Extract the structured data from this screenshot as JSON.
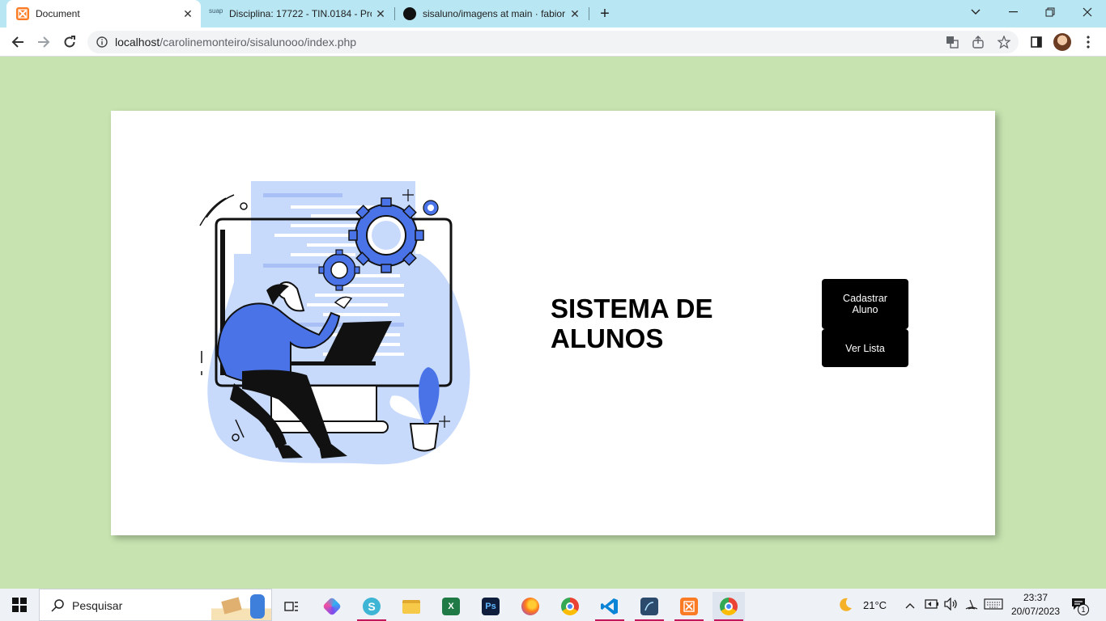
{
  "browser": {
    "tabs": [
      {
        "title": "Document",
        "active": true
      },
      {
        "title": "Disciplina: 17722 - TIN.0184 - Pro",
        "favicon_text": "suap"
      },
      {
        "title": "sisaluno/imagens at main · fabior"
      }
    ],
    "url_host": "localhost",
    "url_path": "/carolinemonteiro/sisalunooo/index.php"
  },
  "page": {
    "title": "SISTEMA DE ALUNOS",
    "buttons": {
      "cadastrar": "Cadastrar Aluno",
      "ver_lista": "Ver Lista"
    }
  },
  "taskbar": {
    "search_placeholder": "Pesquisar",
    "weather": "21°C",
    "time": "23:37",
    "date": "20/07/2023",
    "notifications_count": "1"
  },
  "colors": {
    "background": "#c7e4b0",
    "card": "#ffffff",
    "button": "#000000",
    "illustration_blue": "#4a73e8",
    "illustration_light": "#c8dafc"
  }
}
